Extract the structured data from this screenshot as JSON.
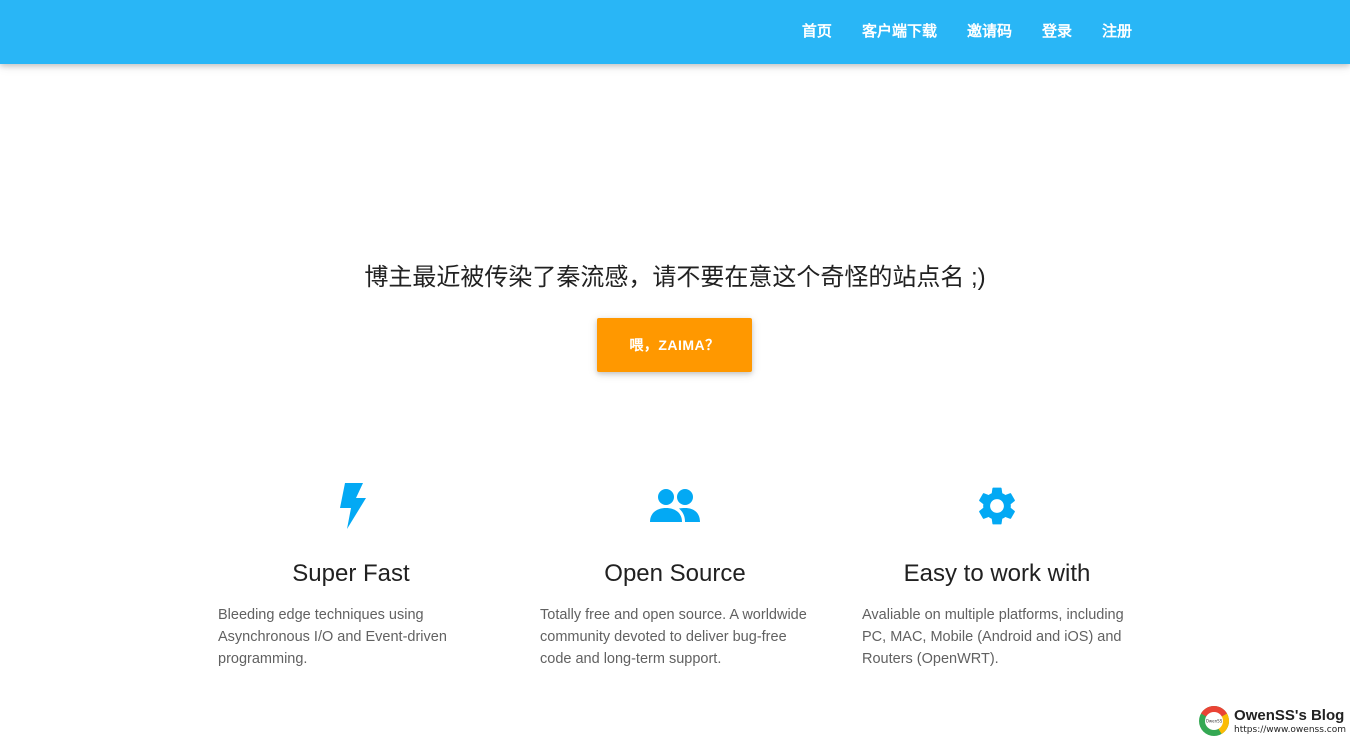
{
  "nav": {
    "items": [
      "首页",
      "客户端下载",
      "邀请码",
      "登录",
      "注册"
    ]
  },
  "hero": {
    "text": "博主最近被传染了秦流感，请不要在意这个奇怪的站点名 ;)",
    "button_label": "喂，ZAIMA？"
  },
  "features": [
    {
      "icon": "bolt-icon",
      "title": "Super Fast",
      "description": "Bleeding edge techniques using Asynchronous I/O and Event-driven programming."
    },
    {
      "icon": "people-icon",
      "title": "Open Source",
      "description": "Totally free and open source. A worldwide community devoted to deliver bug-free code and long-term support."
    },
    {
      "icon": "gear-icon",
      "title": "Easy to work with",
      "description": "Avaliable on multiple platforms, including PC, MAC, Mobile (Android and iOS) and Routers (OpenWRT)."
    }
  ],
  "watermark": {
    "title": "OwenSS's Blog",
    "url": "https://www.owenss.com",
    "logo_text": "OwenSS"
  },
  "colors": {
    "navbar": "#29b6f6",
    "accent_button": "#ff9800",
    "icon": "#03a9f4"
  }
}
